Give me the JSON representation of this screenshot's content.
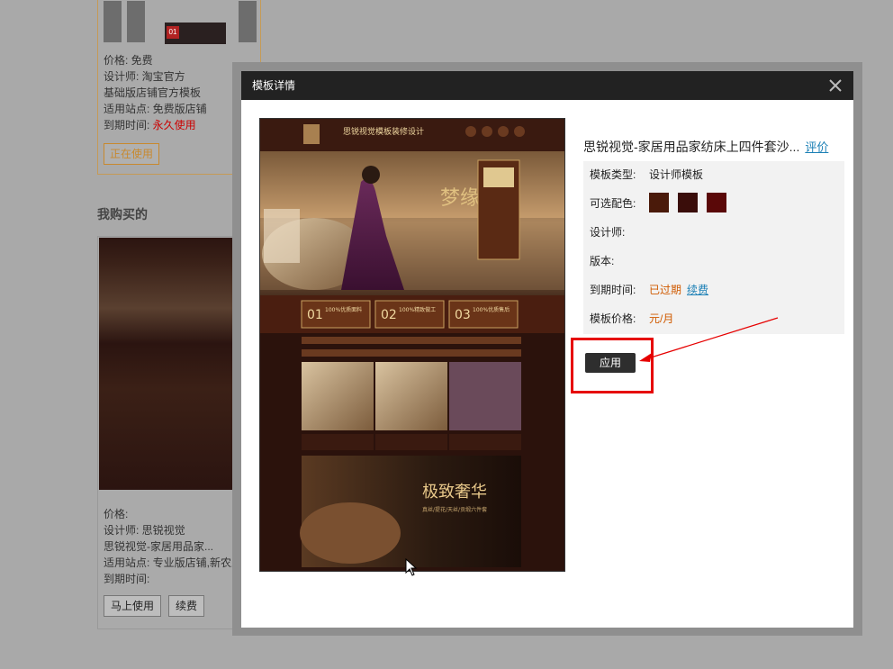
{
  "background": {
    "card1": {
      "thumb_badge": "01",
      "price": "价格: 免费",
      "designer": "设计师: 淘宝官方",
      "template_name": "基础版店铺官方模板",
      "sites": "适用站点: 免费版店铺",
      "expiry_label": "到期时间: ",
      "expiry_value": "永久使用",
      "in_use_button": "正在使用"
    },
    "purchased_title": "我购买的",
    "card2": {
      "price": "价格:",
      "designer": "设计师: 思锐视觉",
      "template_name": "思锐视觉-家居用品家...",
      "sites": "适用站点: 专业版店铺,新农业",
      "expiry": "到期时间:",
      "use_now_button": "马上使用",
      "renew_button": "续费"
    }
  },
  "modal": {
    "title": "模板详情",
    "close_icon": "close-icon",
    "template_title": "思锐视觉-家居用品家纺床上四件套沙...",
    "review_link": "评价",
    "type_label": "模板类型:",
    "type_value": "设计师模板",
    "colors_label": "可选配色:",
    "colors": [
      "#4a1a0a",
      "#3a0d0a",
      "#5a0808"
    ],
    "designer_label": "设计师:",
    "version_label": "版本:",
    "expiry_label": "到期时间:",
    "expiry_value": "已过期",
    "renew_link": "续费",
    "price_label": "模板价格:",
    "price_value": "元/月",
    "apply_button": "应用"
  },
  "preview": {
    "header_title": "思锐视觉模板装修设计",
    "hero_title": "梦缘",
    "feature_badges": [
      {
        "num": "01",
        "text": "100%优质面料"
      },
      {
        "num": "02",
        "text": "100%精致做工"
      },
      {
        "num": "03",
        "text": "100%优质售后"
      }
    ],
    "banner_text": "极致奢华",
    "banner_subtext": "真丝/提花/天丝/贡缎六件套"
  },
  "accent_colors": {
    "highlight_red": "#e60000",
    "link_blue": "#1a7fb5",
    "warning_orange": "#d05a00"
  }
}
